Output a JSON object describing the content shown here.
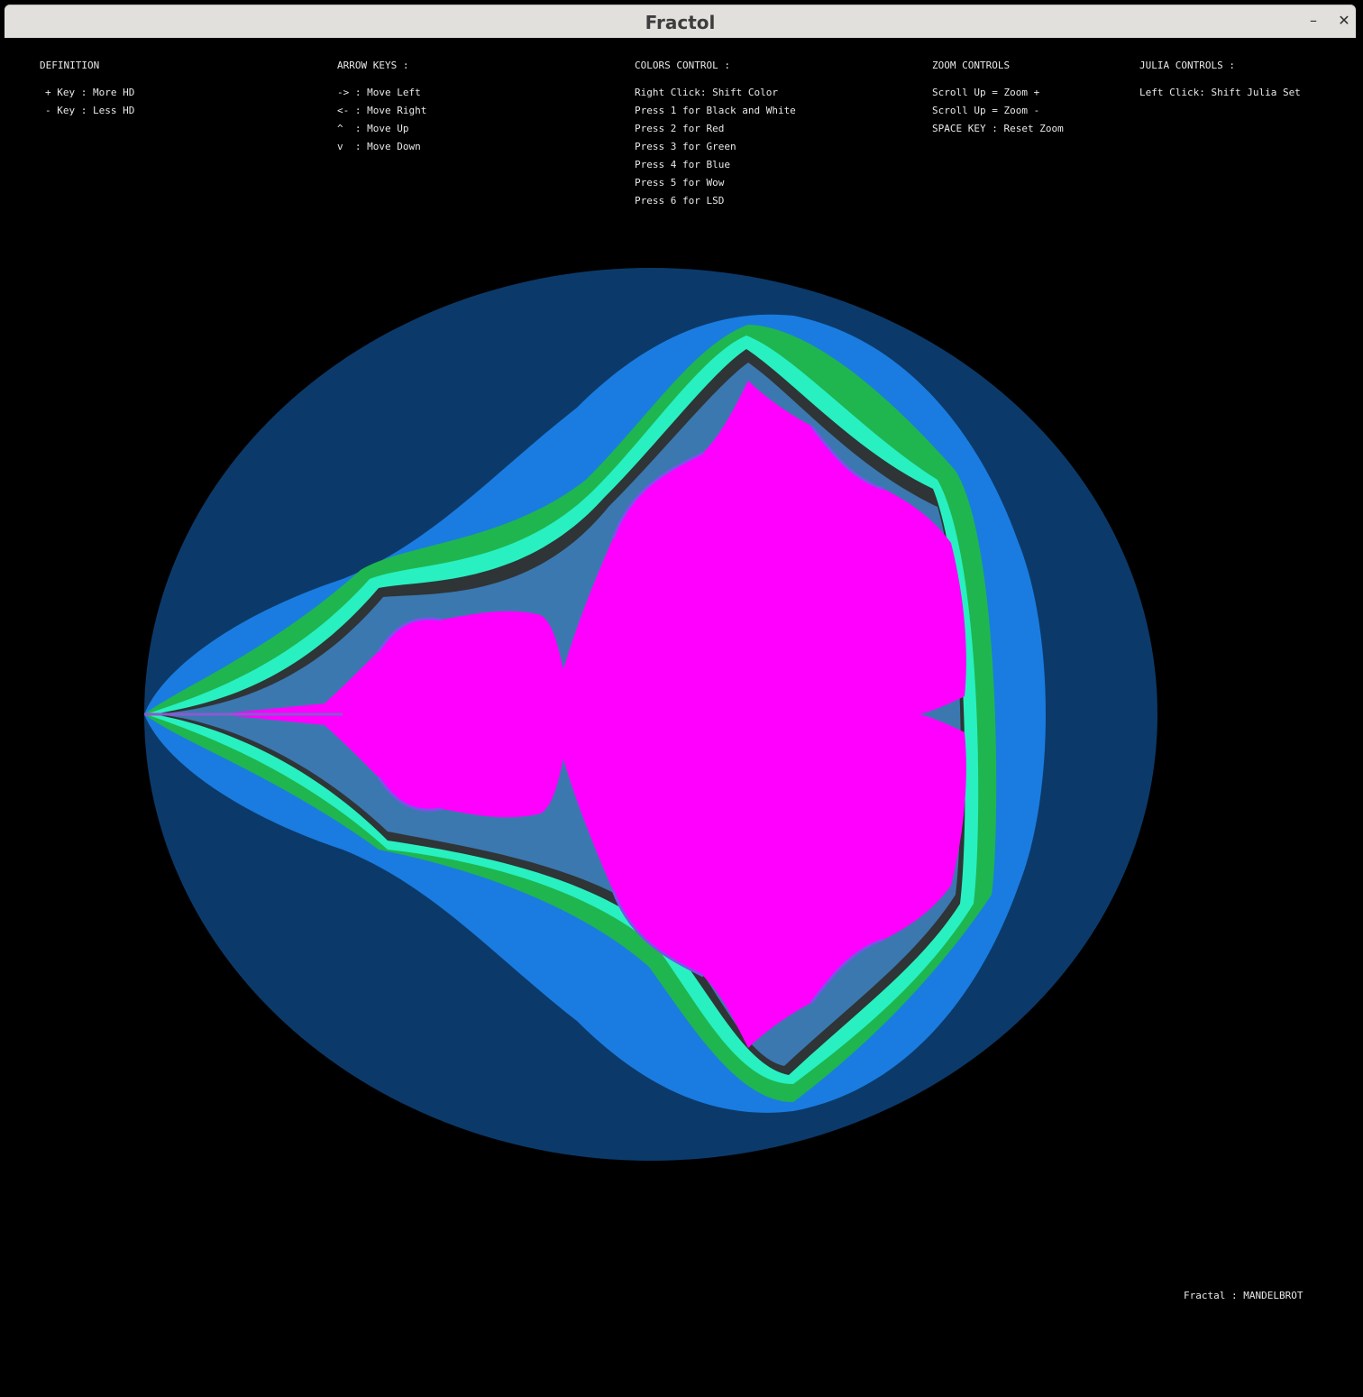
{
  "window": {
    "title": "Fractol",
    "minimize_glyph": "–",
    "close_glyph": "✕"
  },
  "controls": {
    "definition": {
      "header": "DEFINITION",
      "lines": [
        "+ Key : More HD",
        "- Key : Less HD"
      ]
    },
    "arrow_keys": {
      "header": "ARROW KEYS :",
      "lines": [
        "-> : Move Left",
        "<- : Move Right",
        "^  : Move Up",
        "v  : Move Down"
      ]
    },
    "colors_control": {
      "header": "COLORS CONTROL :",
      "lines": [
        "Right Click: Shift Color",
        "Press 1 for Black and White",
        "Press 2 for Red",
        "Press 3 for Green",
        "Press 4 for Blue",
        "Press 5 for Wow",
        "Press 6 for LSD"
      ]
    },
    "zoom_controls": {
      "header": "ZOOM CONTROLS",
      "lines": [
        "Scroll Up = Zoom +",
        "Scroll Up = Zoom -",
        "SPACE KEY : Reset Zoom"
      ]
    },
    "julia_controls": {
      "header": "JULIA CONTROLS :",
      "lines": [
        "Left Click: Shift Julia Set"
      ]
    }
  },
  "status": {
    "fractal_label": "Fractal : MANDELBROT"
  },
  "palette": {
    "background": "#000000",
    "outer": "#0b3a6a",
    "band1": "#1a7ce0",
    "band2": "#1fb650",
    "band3": "#28f0c0",
    "band4": "#2f3436",
    "band5": "#3b78b0",
    "set": "#ff00ff"
  }
}
